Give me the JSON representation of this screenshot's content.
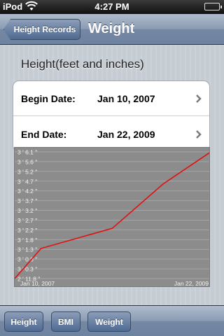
{
  "status_bar": {
    "carrier": "iPod",
    "time": "4:27 PM"
  },
  "nav_bar": {
    "back_label": "Height Records",
    "title": "Weight"
  },
  "section": {
    "header": "Height(feet and inches)"
  },
  "date_range": {
    "begin_label": "Begin Date:",
    "begin_value": "Jan 10, 2007",
    "end_label": "End Date:",
    "end_value": "Jan 22, 2009"
  },
  "toolbar": {
    "buttons": [
      "Height",
      "BMI",
      "Weight"
    ]
  },
  "colors": {
    "line": "#e01010",
    "chart_bg": "#8c8c8c"
  },
  "chart_data": {
    "type": "line",
    "title": "",
    "xlabel": "",
    "ylabel": "",
    "y_tick_labels": [
      "3 ' 6.1 \"",
      "3 ' 5.6 \"",
      "3 ' 5.2 \"",
      "3 ' 4.7 \"",
      "3 ' 4.2 \"",
      "3 ' 3.7 \"",
      "3 ' 3.2 \"",
      "3 ' 2.7 \"",
      "3 ' 2.2 \"",
      "3 ' 1.8 \"",
      "3 ' 1.3 \"",
      "3 ' 0.8 \"",
      "3 ' 0.3 \"",
      "2 ' 11.8 \""
    ],
    "x_tick_labels": [
      "Jan 10, 2007",
      "Jan 22, 2009"
    ],
    "ylim_inches": [
      35.8,
      42.1
    ],
    "xlim": [
      "2007-01-10",
      "2009-01-22"
    ],
    "grid": true,
    "series": [
      {
        "x": [
          "2007-01-10",
          "2007-04-20",
          "2008-01-15",
          "2008-07-25",
          "2009-01-22"
        ],
        "y_inches": [
          35.8,
          37.3,
          38.3,
          40.5,
          42.1
        ]
      }
    ]
  }
}
